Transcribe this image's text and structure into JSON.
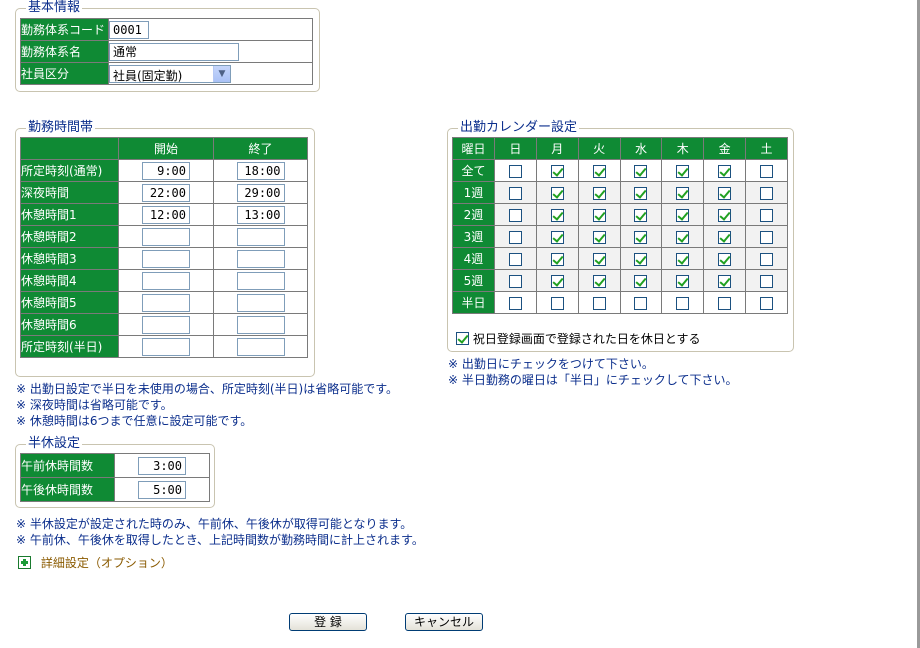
{
  "basic": {
    "legend": "基本情報",
    "rows": [
      {
        "label": "勤務体系コード",
        "value": "0001"
      },
      {
        "label": "勤務体系名",
        "value": "通常"
      },
      {
        "label": "社員区分",
        "value": "社員(固定勤)"
      }
    ]
  },
  "worktime": {
    "legend": "勤務時間帯",
    "col_start": "開始",
    "col_end": "終了",
    "rows": [
      {
        "label": "所定時刻(通常)",
        "start": "9:00",
        "end": "18:00"
      },
      {
        "label": "深夜時間",
        "start": "22:00",
        "end": "29:00"
      },
      {
        "label": "休憩時間1",
        "start": "12:00",
        "end": "13:00"
      },
      {
        "label": "休憩時間2",
        "start": "",
        "end": ""
      },
      {
        "label": "休憩時間3",
        "start": "",
        "end": ""
      },
      {
        "label": "休憩時間4",
        "start": "",
        "end": ""
      },
      {
        "label": "休憩時間5",
        "start": "",
        "end": ""
      },
      {
        "label": "休憩時間6",
        "start": "",
        "end": ""
      },
      {
        "label": "所定時刻(半日)",
        "start": "",
        "end": ""
      }
    ],
    "notes": [
      "※ 出勤日設定で半日を未使用の場合、所定時刻(半日)は省略可能です。",
      "※ 深夜時間は省略可能です。",
      "※ 休憩時間は6つまで任意に設定可能です。"
    ]
  },
  "calendar": {
    "legend": "出勤カレンダー設定",
    "corner": "曜日",
    "days": [
      "日",
      "月",
      "火",
      "水",
      "木",
      "金",
      "土"
    ],
    "rows": [
      {
        "label": "全て",
        "checks": [
          false,
          true,
          true,
          true,
          true,
          true,
          false
        ]
      },
      {
        "label": "1週",
        "checks": [
          false,
          true,
          true,
          true,
          true,
          true,
          false
        ]
      },
      {
        "label": "2週",
        "checks": [
          false,
          true,
          true,
          true,
          true,
          true,
          false
        ]
      },
      {
        "label": "3週",
        "checks": [
          false,
          true,
          true,
          true,
          true,
          true,
          false
        ]
      },
      {
        "label": "4週",
        "checks": [
          false,
          true,
          true,
          true,
          true,
          true,
          false
        ]
      },
      {
        "label": "5週",
        "checks": [
          false,
          true,
          true,
          true,
          true,
          true,
          false
        ]
      },
      {
        "label": "半日",
        "checks": [
          false,
          false,
          false,
          false,
          false,
          false,
          false
        ]
      }
    ],
    "holiday_label": "祝日登録画面で登録された日を休日とする",
    "holiday_checked": true,
    "notes": [
      "※ 出勤日にチェックをつけて下さい。",
      "※ 半日勤務の曜日は「半日」にチェックして下さい。"
    ]
  },
  "halfday": {
    "legend": "半休設定",
    "rows": [
      {
        "label": "午前休時間数",
        "value": "3:00"
      },
      {
        "label": "午後休時間数",
        "value": "5:00"
      }
    ],
    "notes": [
      "※ 半休設定が設定された時のみ、午前休、午後休が取得可能となります。",
      "※ 午前休、午後休を取得したとき、上記時間数が勤務時間に計上されます。"
    ]
  },
  "detail_link": "詳細設定（オプション）",
  "buttons": {
    "register": "登 録",
    "cancel": "キャンセル"
  },
  "colors": {
    "header_green": "#0f8a34",
    "legend_blue": "#0b2e8c",
    "check_green": "#21a121"
  },
  "icons": {
    "expand": "plus-square-icon",
    "dropdown": "chevron-down-icon"
  }
}
